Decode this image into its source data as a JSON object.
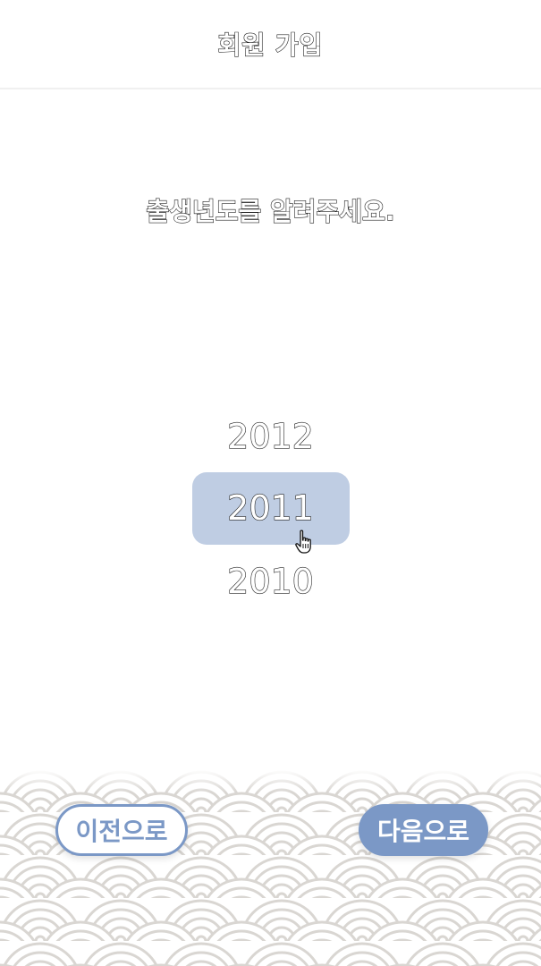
{
  "header": {
    "title": "회원 가입"
  },
  "question": {
    "text": "출생년도를 알려주세요."
  },
  "year_picker": {
    "items": [
      "2012",
      "2011",
      "2010"
    ],
    "selected": "2011"
  },
  "buttons": {
    "prev_label": "이전으로",
    "next_label": "다음으로"
  },
  "colors": {
    "accent": "#7b98c6",
    "selected_bg": "#bfcde3",
    "pattern": "#d9d6d2"
  },
  "icons": {
    "cursor": "hand-pointer-cursor-icon",
    "background": "seigaiha-wave-pattern"
  }
}
